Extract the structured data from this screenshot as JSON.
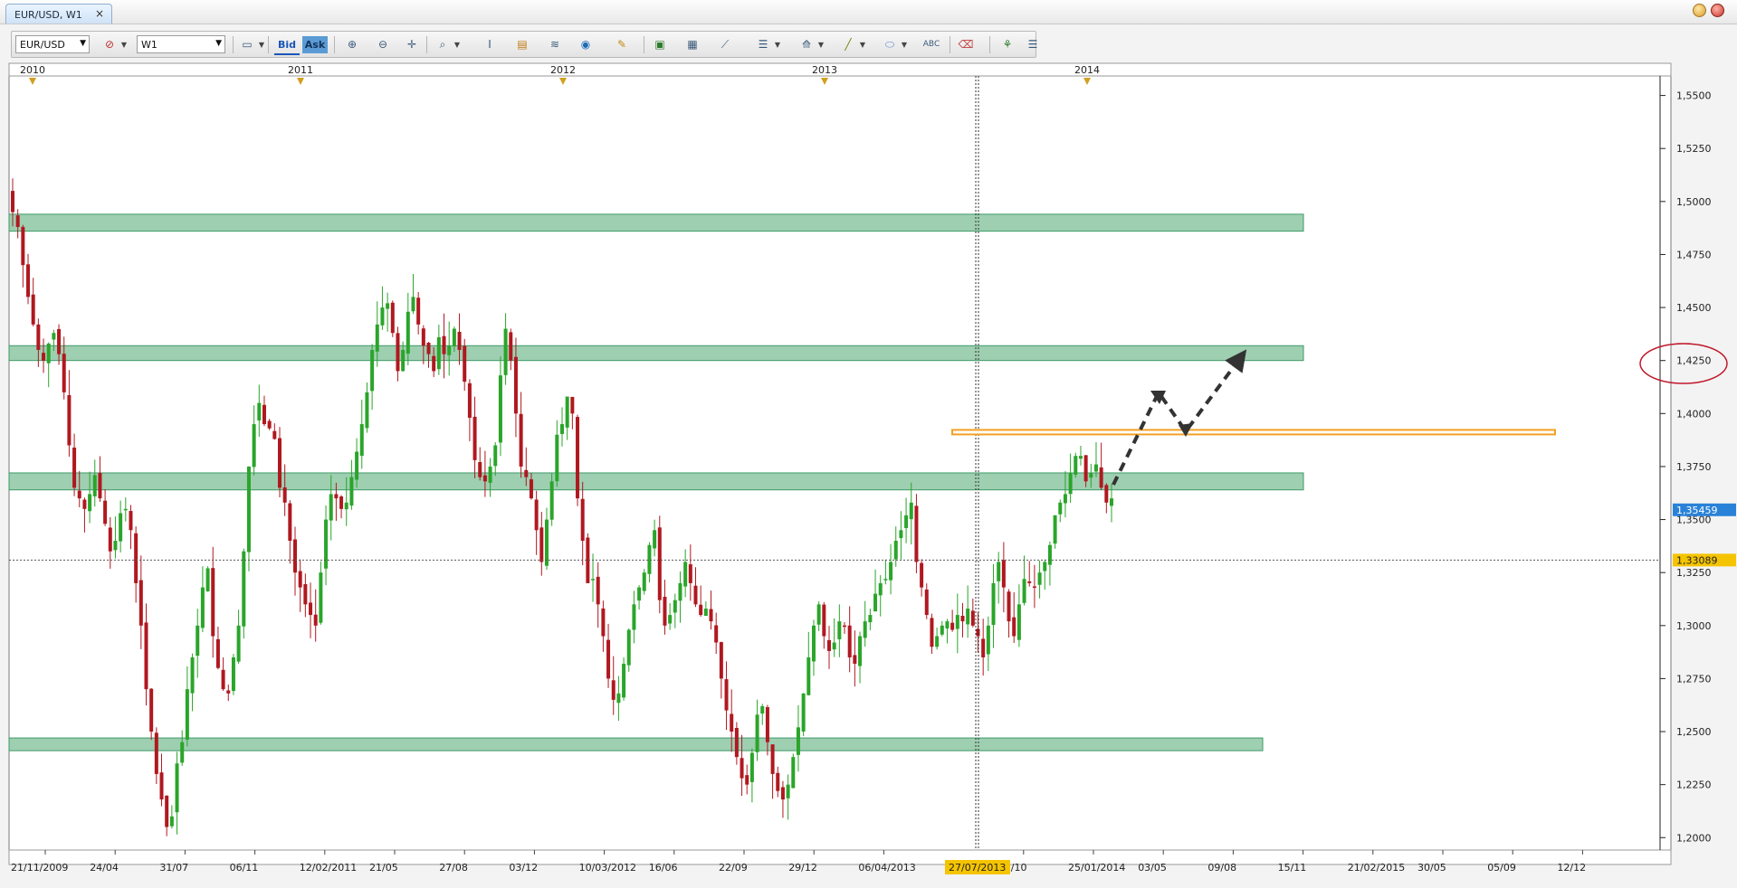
{
  "window": {
    "tab_title": "EUR/USD, W1",
    "tab_close": "×"
  },
  "toolbar": {
    "symbol": "EUR/USD",
    "timeframe": "W1",
    "bid_label": "Bid",
    "ask_label": "Ask"
  },
  "colors": {
    "bull": "#2aa52a",
    "bear": "#b01820",
    "zone_fill": "#9ecfb1",
    "zone_stroke": "#3e9a68",
    "resistance_line": "#f2a024",
    "arrow": "#333333",
    "ellipse": "#c0182a",
    "price_current_bg": "#2a82d8",
    "price_cursor_bg": "#f5c400"
  },
  "axes": {
    "price_labels": [
      "1,5500",
      "1,5250",
      "1,5000",
      "1,4750",
      "1,4500",
      "1,4250",
      "1,4000",
      "1,3750",
      "1,3500",
      "1,3250",
      "1,3000",
      "1,2750",
      "1,2500",
      "1,2250",
      "1,2000"
    ],
    "year_labels": [
      "2010",
      "2011",
      "2012",
      "2013",
      "2014"
    ],
    "date_labels": [
      "21/11/2009",
      "24/04",
      "31/07",
      "06/11",
      "12/02/2011",
      "21/05",
      "27/08",
      "03/12",
      "10/03/2012",
      "16/06",
      "22/09",
      "29/12",
      "06/04/2013",
      "27/07/2013",
      "19/10",
      "25/01/2014",
      "03/05",
      "09/08",
      "15/11",
      "21/02/2015",
      "30/05",
      "05/09",
      "12/12"
    ],
    "current_price": "1,35459",
    "cursor_price": "1,33089",
    "cursor_date": "27/07/2013"
  },
  "chart_data": {
    "type": "candlestick",
    "symbol": "EUR/USD",
    "timeframe": "W1",
    "ylim": [
      1.195,
      1.5575
    ],
    "zones": [
      {
        "low": 1.486,
        "high": 1.494,
        "x_end": 1.6
      },
      {
        "low": 1.425,
        "high": 1.432,
        "x_end": 1.6
      },
      {
        "low": 1.364,
        "high": 1.372,
        "x_end": 1.6
      },
      {
        "low": 1.241,
        "high": 1.247,
        "x_end": 1.55
      }
    ],
    "resistance": {
      "price": 1.391
    },
    "close_path": [
      1.495,
      1.488,
      1.47,
      1.455,
      1.442,
      1.43,
      1.425,
      1.433,
      1.438,
      1.428,
      1.41,
      1.385,
      1.365,
      1.36,
      1.355,
      1.362,
      1.371,
      1.36,
      1.348,
      1.335,
      1.34,
      1.353,
      1.355,
      1.345,
      1.32,
      1.3,
      1.27,
      1.25,
      1.23,
      1.218,
      1.205,
      1.21,
      1.235,
      1.245,
      1.27,
      1.285,
      1.3,
      1.318,
      1.327,
      1.295,
      1.28,
      1.27,
      1.268,
      1.285,
      1.3,
      1.335,
      1.375,
      1.395,
      1.405,
      1.395,
      1.393,
      1.388,
      1.365,
      1.358,
      1.34,
      1.325,
      1.318,
      1.31,
      1.305,
      1.3,
      1.325,
      1.35,
      1.362,
      1.36,
      1.355,
      1.358,
      1.37,
      1.382,
      1.395,
      1.41,
      1.43,
      1.442,
      1.45,
      1.452,
      1.438,
      1.42,
      1.43,
      1.448,
      1.455,
      1.442,
      1.432,
      1.428,
      1.42,
      1.436,
      1.428,
      1.432,
      1.44,
      1.43,
      1.415,
      1.398,
      1.378,
      1.37,
      1.368,
      1.375,
      1.385,
      1.418,
      1.44,
      1.425,
      1.4,
      1.375,
      1.37,
      1.36,
      1.345,
      1.33,
      1.35,
      1.368,
      1.39,
      1.395,
      1.408,
      1.4,
      1.36,
      1.34,
      1.32,
      1.322,
      1.31,
      1.295,
      1.275,
      1.265,
      1.268,
      1.282,
      1.298,
      1.31,
      1.318,
      1.325,
      1.338,
      1.345,
      1.312,
      1.3,
      1.305,
      1.312,
      1.32,
      1.33,
      1.32,
      1.31,
      1.305,
      1.308,
      1.302,
      1.292,
      1.275,
      1.26,
      1.25,
      1.238,
      1.228,
      1.225,
      1.24,
      1.258,
      1.262,
      1.245,
      1.23,
      1.222,
      1.218,
      1.225,
      1.238,
      1.252,
      1.268,
      1.285,
      1.3,
      1.31,
      1.295,
      1.288,
      1.292,
      1.302,
      1.3,
      1.285,
      1.282,
      1.295,
      1.302,
      1.305,
      1.315,
      1.32,
      1.322,
      1.33,
      1.34,
      1.345,
      1.352,
      1.358,
      1.33,
      1.318,
      1.305,
      1.29,
      1.295,
      1.3,
      1.302,
      1.298,
      1.305,
      1.302,
      1.308,
      1.3,
      1.295,
      1.285,
      1.3,
      1.32,
      1.33,
      1.318,
      1.302,
      1.295,
      1.31,
      1.322,
      1.32,
      1.318,
      1.325,
      1.33,
      1.338,
      1.352,
      1.358,
      1.362,
      1.372,
      1.38,
      1.38,
      1.368,
      1.372,
      1.376,
      1.365,
      1.358,
      1.36
    ]
  }
}
